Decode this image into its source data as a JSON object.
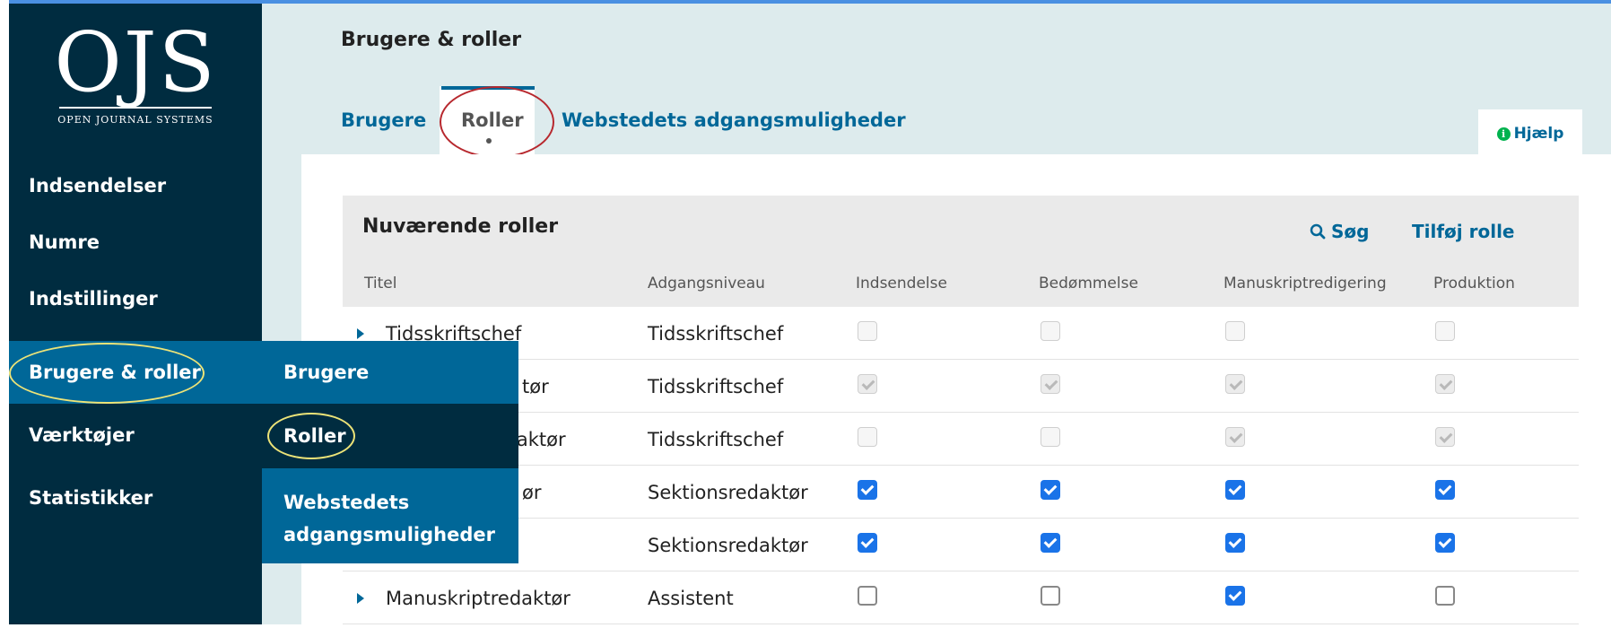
{
  "logo": {
    "mark": "OJS",
    "subtitle": "OPEN JOURNAL SYSTEMS"
  },
  "sidebar": {
    "items": [
      {
        "label": "Indsendelser"
      },
      {
        "label": "Numre"
      },
      {
        "label": "Indstillinger"
      },
      {
        "label": "Brugere & roller"
      },
      {
        "label": "Værktøjer"
      },
      {
        "label": "Statistikker"
      }
    ]
  },
  "submenu": {
    "items": [
      {
        "label": "Brugere"
      },
      {
        "label": "Roller"
      },
      {
        "label": "Webstedets adgangsmuligheder"
      }
    ]
  },
  "page": {
    "title": "Brugere & roller"
  },
  "tabs": [
    {
      "label": "Brugere"
    },
    {
      "label": "Roller"
    },
    {
      "label": "Webstedets adgangsmuligheder"
    }
  ],
  "help": {
    "label": "Hjælp",
    "icon": "info-icon"
  },
  "grid": {
    "title": "Nuværende roller",
    "search_label": "Søg",
    "add_label": "Tilføj rolle",
    "columns": [
      "Titel",
      "Adgangsniveau",
      "Indsendelse",
      "Bedømmelse",
      "Manuskriptredigering",
      "Produktion"
    ],
    "rows": [
      {
        "name": "Tidsskriftschef",
        "access": "Tidsskriftschef",
        "checks": [
          "disabled-unchecked",
          "disabled-unchecked",
          "disabled-unchecked",
          "disabled-unchecked"
        ]
      },
      {
        "name": "tør",
        "access": "Tidsskriftschef",
        "checks": [
          "disabled-checked",
          "disabled-checked",
          "disabled-checked",
          "disabled-checked"
        ]
      },
      {
        "name": "laktør",
        "access": "Tidsskriftschef",
        "checks": [
          "disabled-unchecked",
          "disabled-unchecked",
          "disabled-checked",
          "disabled-checked"
        ]
      },
      {
        "name": "ør",
        "access": "Sektionsredaktør",
        "checks": [
          "checked",
          "checked",
          "checked",
          "checked"
        ]
      },
      {
        "name": "",
        "access": "Sektionsredaktør",
        "checks": [
          "checked",
          "checked",
          "checked",
          "checked"
        ]
      },
      {
        "name": "Manuskriptredaktør",
        "access": "Assistent",
        "checks": [
          "unchecked",
          "unchecked",
          "checked",
          "unchecked"
        ]
      }
    ]
  },
  "colors": {
    "sidebar": "#002c40",
    "accent": "#006798",
    "highlight_ellipse": "#ece378",
    "tab_ellipse": "#b7282e",
    "checkbox": "#1a73e8"
  }
}
